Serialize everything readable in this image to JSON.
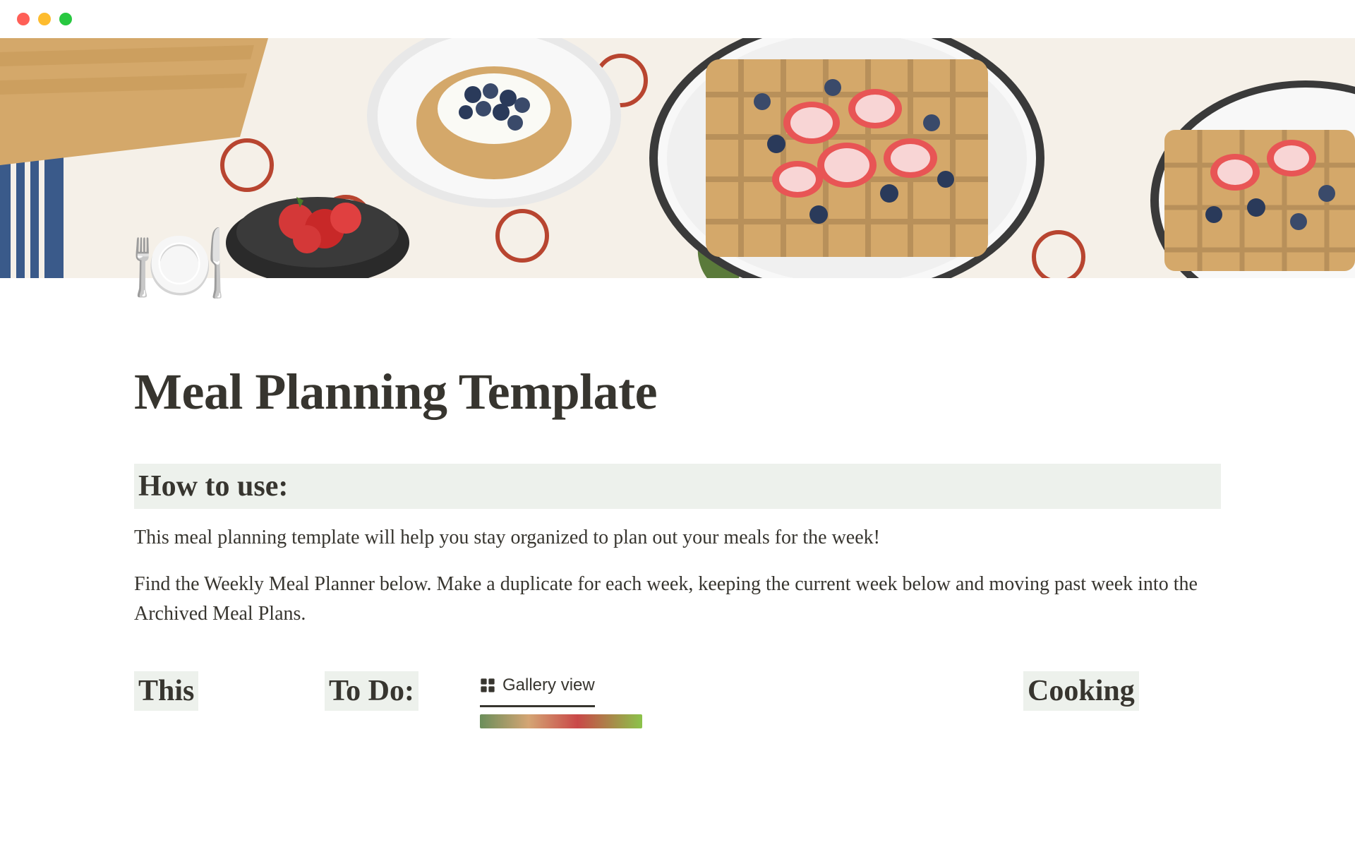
{
  "page": {
    "icon": "🍽️",
    "title": "Meal Planning Template"
  },
  "sections": {
    "howToUse": {
      "heading": "How to use:",
      "para1": "This meal planning template will help you stay organized to plan out your meals for the week!",
      "para2": "Find the Weekly Meal Planner below. Make a duplicate for each week, keeping the current week below and moving past week into the Archived Meal Plans."
    }
  },
  "columns": {
    "thisWeek": "This",
    "toDo": "To Do:",
    "galleryView": "Gallery view",
    "cooking": "Cooking"
  }
}
